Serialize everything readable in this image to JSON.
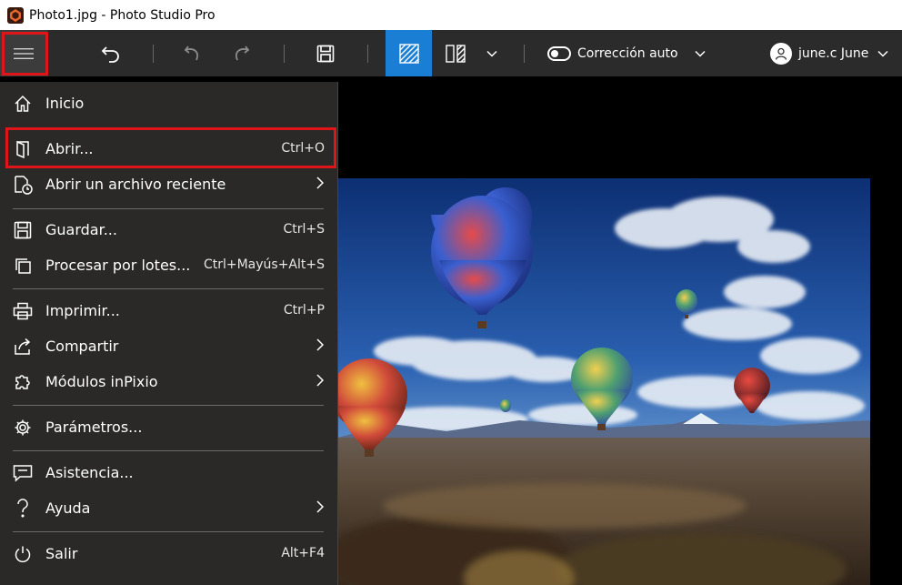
{
  "window": {
    "title": "Photo1.jpg - Photo Studio Pro"
  },
  "toolbar": {
    "auto_correction_label": "Corrección auto",
    "user_name": "june.c June"
  },
  "menu": {
    "items": [
      {
        "label": "Inicio",
        "shortcut": ""
      },
      {
        "label": "Abrir...",
        "shortcut": "Ctrl+O"
      },
      {
        "label": "Abrir un archivo reciente",
        "shortcut": ""
      },
      {
        "label": "Guardar...",
        "shortcut": "Ctrl+S"
      },
      {
        "label": "Procesar por lotes...",
        "shortcut": "Ctrl+Mayús+Alt+S"
      },
      {
        "label": "Imprimir...",
        "shortcut": "Ctrl+P"
      },
      {
        "label": "Compartir",
        "shortcut": ""
      },
      {
        "label": "Módulos inPixio",
        "shortcut": ""
      },
      {
        "label": "Parámetros...",
        "shortcut": ""
      },
      {
        "label": "Asistencia...",
        "shortcut": ""
      },
      {
        "label": "Ayuda",
        "shortcut": ""
      },
      {
        "label": "Salir",
        "shortcut": "Alt+F4"
      }
    ]
  },
  "colors": {
    "accent": "#1a7fd4",
    "highlight": "#e0151a",
    "toolbar": "#2b2b2b",
    "menu_bg": "#2a2927"
  },
  "icons": {
    "menu": "hamburger-icon",
    "undo": "undo-icon",
    "redo": "redo-icon",
    "save": "save-icon",
    "single_view": "single-view-icon",
    "compare_view": "compare-view-icon",
    "user": "user-icon",
    "home": "home-icon",
    "open": "open-icon",
    "recent": "recent-file-icon",
    "batch": "batch-icon",
    "print": "print-icon",
    "share": "share-icon",
    "modules": "puzzle-icon",
    "settings": "gear-icon",
    "support": "chat-icon",
    "help": "question-icon",
    "exit": "power-icon"
  }
}
